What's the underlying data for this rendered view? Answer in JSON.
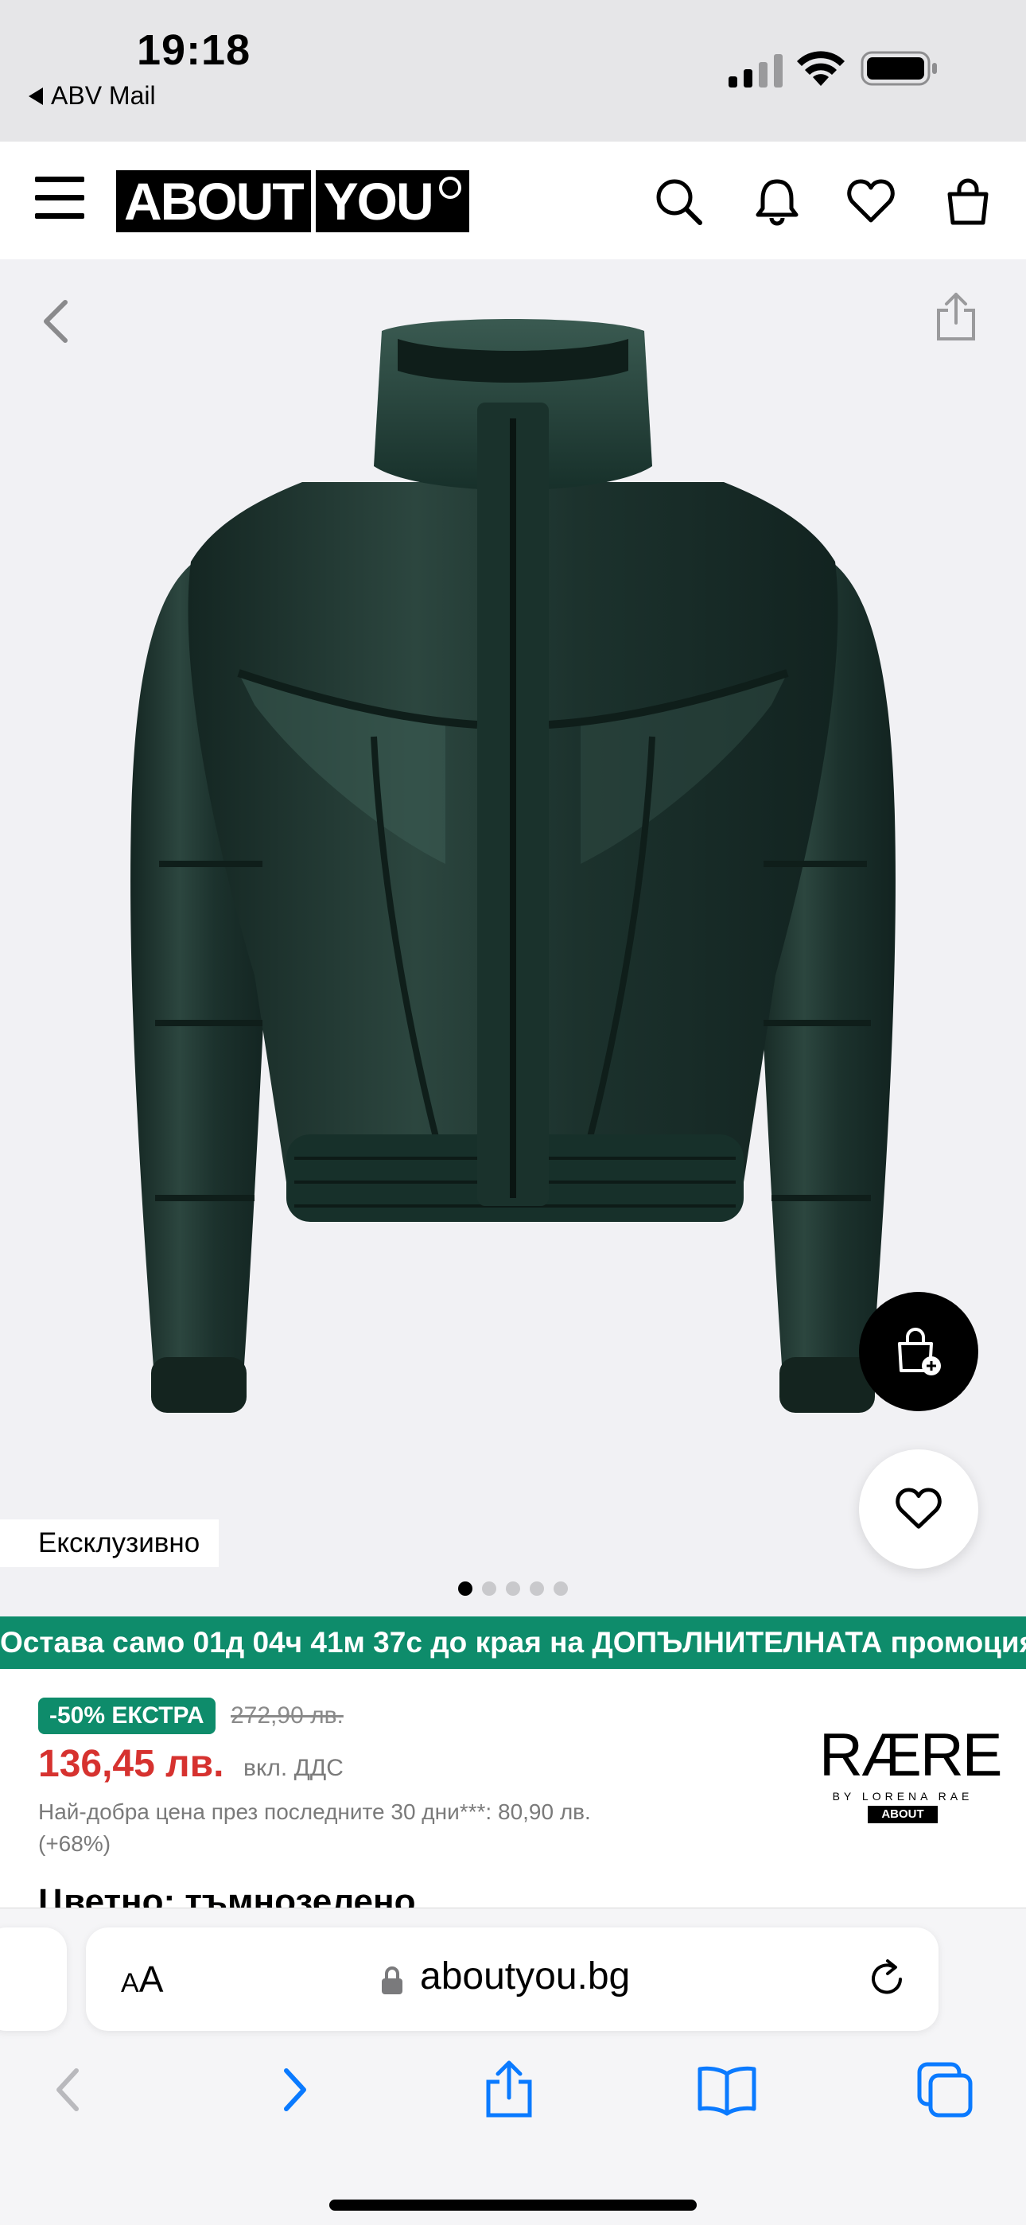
{
  "status_bar": {
    "time": "19:18",
    "back_app": "ABV Mail"
  },
  "header": {
    "logo_left": "ABOUT",
    "logo_right": "YOU"
  },
  "product": {
    "label_exclusive": "Ексклузивно",
    "gallery_dots": 5,
    "gallery_active_index": 0,
    "jacket_color": "#1f332f"
  },
  "promo": {
    "text": "Остава само 01д 04ч 41м 37с до края на ДОПЪЛНИТЕЛНАТА промоция"
  },
  "pricing": {
    "discount_badge": "-50% ЕКСТРА",
    "old_price": "272,90 лв.",
    "new_price": "136,45 лв.",
    "vat_note": "вкл. ДДС",
    "best_price_note": "Най-добра цена през последните 30 дни***: 80,90 лв. (+68%)",
    "accent_green": "#0e8c6b",
    "price_red": "#d6322f"
  },
  "brand": {
    "name": "RÆRE",
    "by_line": "BY LORENA RAE",
    "tag": "ABOUT YOU"
  },
  "color_heading": "Цветно: тъмнозелено",
  "safari": {
    "text_size_label": "AA",
    "url": "aboutyou.bg"
  }
}
